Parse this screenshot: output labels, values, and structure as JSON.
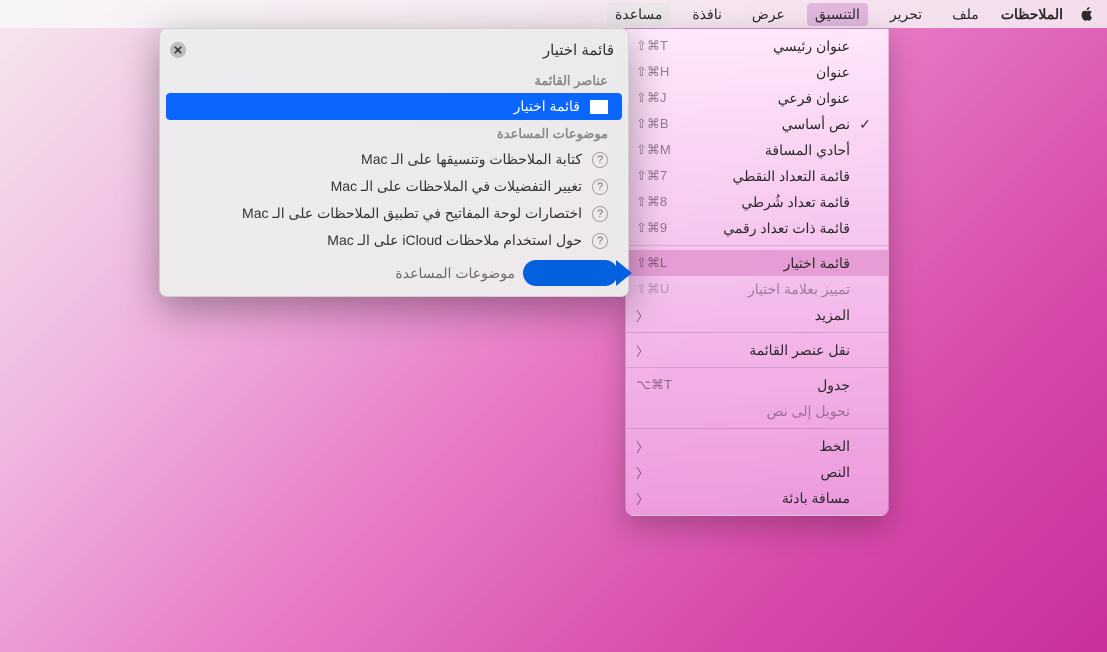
{
  "menubar": {
    "app": "الملاحظات",
    "file": "ملف",
    "edit": "تحرير",
    "format": "التنسيق",
    "view": "عرض",
    "window": "نافذة",
    "help": "مساعدة"
  },
  "format_menu": {
    "title": {
      "label": "عنوان رئيسي",
      "shortcut": "⇧⌘T"
    },
    "heading": {
      "label": "عنوان",
      "shortcut": "⇧⌘H"
    },
    "subheading": {
      "label": "عنوان فرعي",
      "shortcut": "⇧⌘J"
    },
    "body": {
      "label": "نص أساسي",
      "shortcut": "⇧⌘B"
    },
    "monospaced": {
      "label": "أحادي المسافة",
      "shortcut": "⇧⌘M"
    },
    "bulleted": {
      "label": "قائمة التعداد النقطي",
      "shortcut": "⇧⌘7"
    },
    "dashed": {
      "label": "قائمة تعداد شُرطي",
      "shortcut": "⇧⌘8"
    },
    "numbered": {
      "label": "قائمة ذات تعداد رقمي",
      "shortcut": "⇧⌘9"
    },
    "checklist": {
      "label": "قائمة اختيار",
      "shortcut": "⇧⌘L"
    },
    "mark": {
      "label": "تمييز بعلامة اختيار",
      "shortcut": "⇧⌘U"
    },
    "more": {
      "label": "المزيد"
    },
    "move_item": {
      "label": "نقل عنصر القائمة"
    },
    "table": {
      "label": "جدول",
      "shortcut": "⌥⌘T"
    },
    "convert_text": {
      "label": "تحويل إلى نص"
    },
    "font": {
      "label": "الخط"
    },
    "text": {
      "label": "النص"
    },
    "indent": {
      "label": "مسافة بادئة"
    }
  },
  "help_panel": {
    "search_value": "قائمة اختيار",
    "section_menu_items": "عناصر القائمة",
    "menu_result": "قائمة اختيار",
    "section_help_topics": "موضوعات المساعدة",
    "topics": {
      "t1": "كتابة الملاحظات وتنسيقها على الـ Mac",
      "t2": "تغيير التفضيلات في الملاحظات على الـ Mac",
      "t3": "اختصارات لوحة المفاتيح في تطبيق الملاحظات على الـ Mac",
      "t4": "حول استخدام ملاحظات iCloud على الـ Mac"
    },
    "footer_text": "موضوعات المساعدة"
  }
}
